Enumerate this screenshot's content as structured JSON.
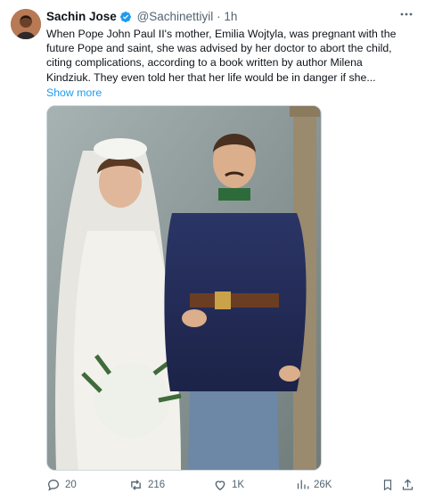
{
  "tweet": {
    "author_name": "Sachin Jose",
    "handle": "@Sachinettiyil",
    "separator": "·",
    "time": "1h",
    "text": "When Pope John Paul II's mother, Emilia Wojtyla, was pregnant with the future Pope and saint, she was advised by her doctor to abort the child, citing complications, according to a book written by author Milena Kindziuk. They even told her that her life would be in danger if she...",
    "show_more": "Show more",
    "more_icon": "more-horizontal-icon",
    "verified_icon": "verified-badge-icon"
  },
  "actions": {
    "replies": "20",
    "reposts": "216",
    "likes": "1K",
    "views": "26K"
  },
  "colors": {
    "accent": "#1d9bf0",
    "text": "#0f1419",
    "secondary": "#536471",
    "border": "#cfd9de"
  }
}
